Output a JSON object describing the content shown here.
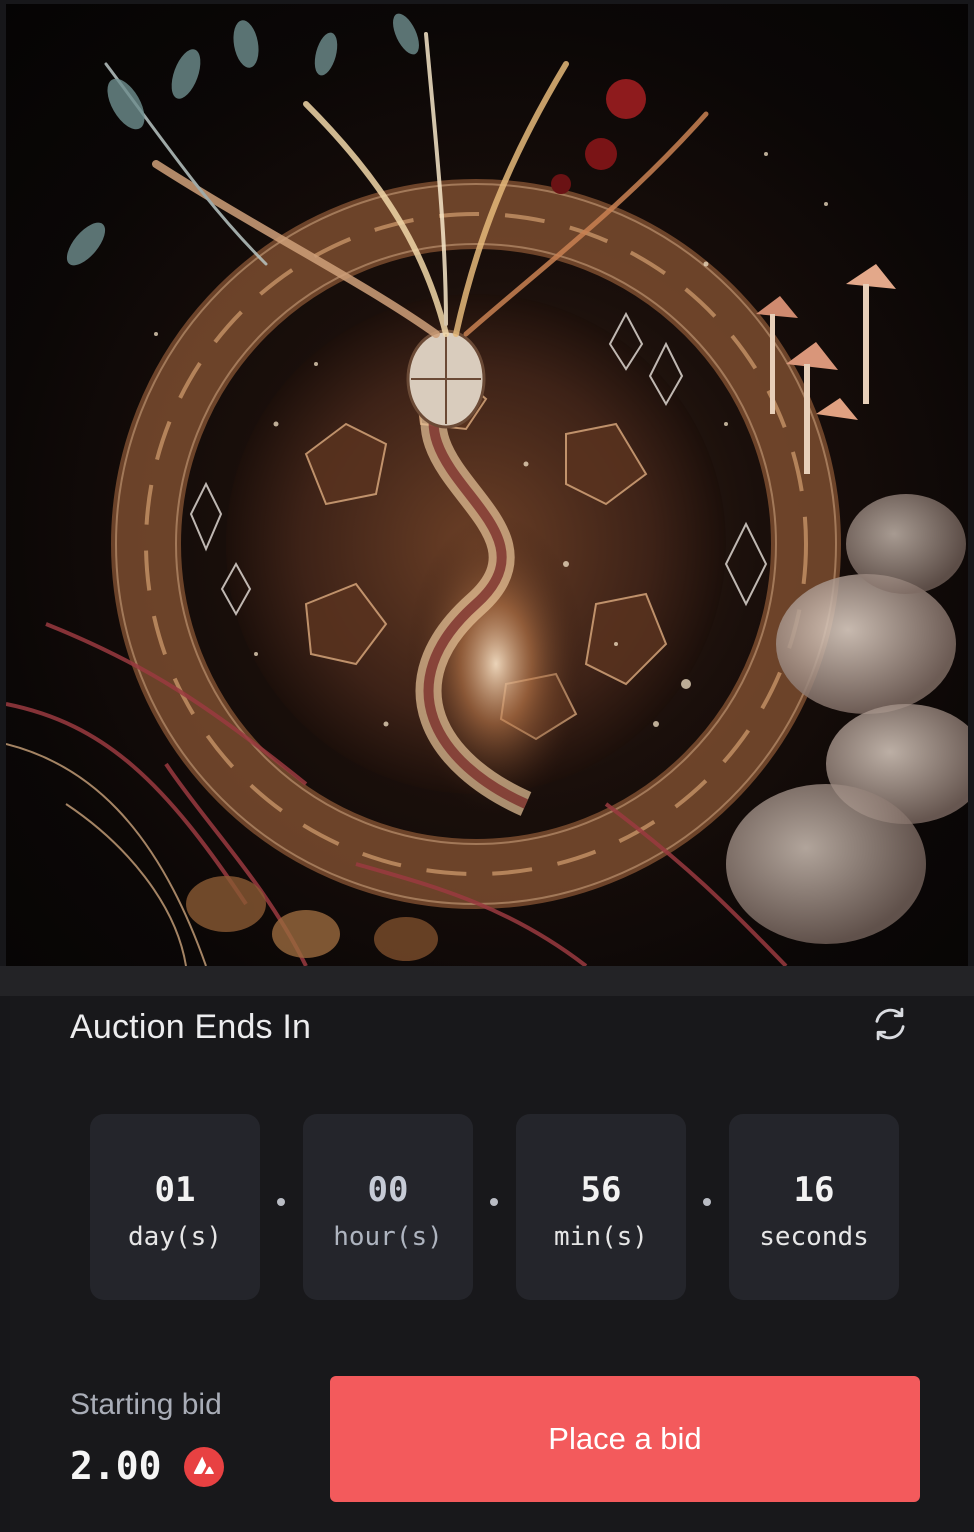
{
  "artwork": {
    "icon": "psychedelic-turtle-artwork"
  },
  "auction": {
    "title": "Auction Ends In",
    "refresh_icon": "refresh-icon",
    "countdown": [
      {
        "value": "01",
        "unit": "day(s)"
      },
      {
        "value": "00",
        "unit": "hour(s)"
      },
      {
        "value": "56",
        "unit": "min(s)"
      },
      {
        "value": "16",
        "unit": "seconds"
      }
    ],
    "separator": "."
  },
  "bid": {
    "label": "Starting bid",
    "amount": "2.00",
    "currency_icon": "avalanche-icon",
    "currency_color": "#e84142",
    "button_label": "Place a bid",
    "button_color": "#f35a5c"
  }
}
